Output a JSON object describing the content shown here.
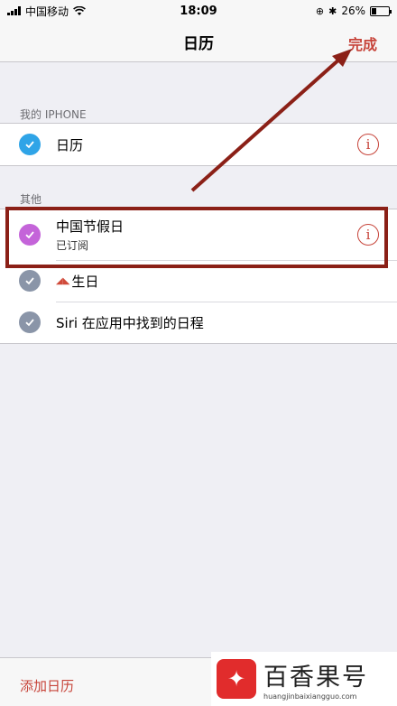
{
  "status_bar": {
    "carrier": "中国移动",
    "time": "18:09",
    "battery_text": "26%",
    "battery_level": 0.26
  },
  "nav": {
    "title": "日历",
    "done_label": "完成"
  },
  "sections": {
    "iphone_header": "我的 IPHONE",
    "other_header": "其他"
  },
  "iphone_calendars": [
    {
      "label": "日历",
      "checked": true,
      "color": "#2fa4e7"
    }
  ],
  "other_calendars": [
    {
      "label": "中国节假日",
      "sublabel": "已订阅",
      "checked": true,
      "color": "#c464d9"
    },
    {
      "label": "生日",
      "icon": "gift-icon",
      "checked": true,
      "color": "#8a95a8"
    },
    {
      "label": "Siri 在应用中找到的日程",
      "checked": true,
      "color": "#8a95a8"
    }
  ],
  "footer": {
    "add_calendar_label": "添加日历"
  },
  "watermark": {
    "name": "百香果号",
    "url": "huangjinbaixiangguo.com"
  },
  "colors": {
    "accent": "#c7443a",
    "annotation": "#8b2017"
  }
}
